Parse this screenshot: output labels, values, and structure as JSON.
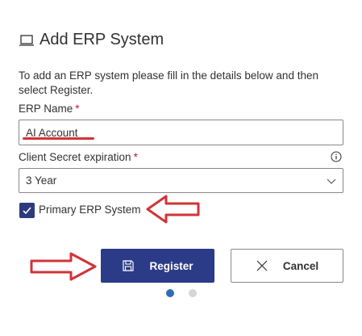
{
  "dialog": {
    "icon": "laptop-icon",
    "title": "Add ERP System",
    "description": "To add an ERP system please fill in the details below and then select Register."
  },
  "form": {
    "erp_name": {
      "label": "ERP Name",
      "required_mark": "*",
      "value": "AI Account"
    },
    "client_secret": {
      "label": "Client Secret expiration",
      "required_mark": "*",
      "value": "3 Year",
      "info_icon": "info-icon"
    },
    "primary": {
      "label": "Primary ERP System",
      "checked": true
    }
  },
  "buttons": {
    "register": {
      "label": "Register",
      "icon": "save-icon"
    },
    "cancel": {
      "label": "Cancel",
      "icon": "close-icon"
    }
  },
  "pagination": {
    "current": 1,
    "total": 2
  },
  "colors": {
    "primary": "#2b3b88",
    "annotation": "#d13438",
    "required": "#a4262c",
    "dot_active": "#2f6db3",
    "dot_inactive": "#d6d6d6"
  }
}
